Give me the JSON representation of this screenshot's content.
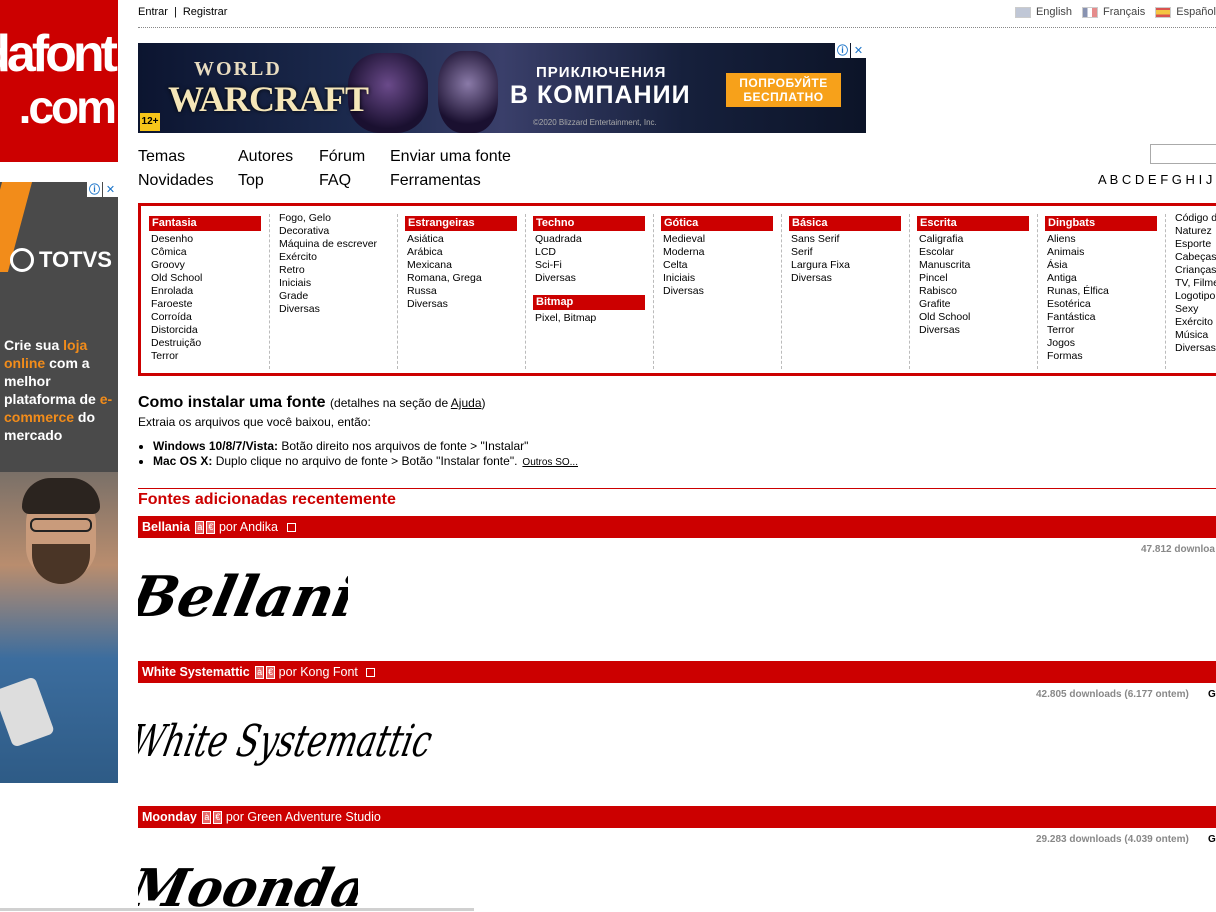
{
  "logo": {
    "line1": "dafont",
    "line2": ".com"
  },
  "left_ad": {
    "brand": "TOTVS",
    "copy_1": "Crie sua ",
    "copy_hl1": "loja online",
    "copy_2": " com a melhor plataforma de ",
    "copy_hl2": "e-commerce",
    "copy_3": " do mercado"
  },
  "top_links": {
    "login": "Entrar",
    "separator": "|",
    "register": "Registrar"
  },
  "languages": [
    {
      "flag": "en",
      "label": "English"
    },
    {
      "flag": "fr",
      "label": "Français"
    },
    {
      "flag": "es",
      "label": "Español"
    }
  ],
  "top_ad": {
    "world": "WORLD",
    "warcraft": "WARCRAFT",
    "line1": "ПРИКЛЮЧЕНИЯ",
    "line2": "В КОМПАНИИ",
    "cta": "ПОПРОБУЙТЕ БЕСПЛАТНО",
    "copyright": "©2020 Blizzard Entertainment, Inc.",
    "rating": "12+"
  },
  "nav": {
    "temas": "Temas",
    "novidades": "Novidades",
    "autores": "Autores",
    "top": "Top",
    "forum": "Fórum",
    "faq": "FAQ",
    "enviar": "Enviar uma fonte",
    "ferramentas": "Ferramentas"
  },
  "alphabet": [
    "A",
    "B",
    "C",
    "D",
    "E",
    "F",
    "G",
    "H",
    "I",
    "J"
  ],
  "categories": {
    "fantasia": {
      "title": "Fantasia",
      "items": [
        "Desenho",
        "Cômica",
        "Groovy",
        "Old School",
        "Enrolada",
        "Faroeste",
        "Corroída",
        "Distorcida",
        "Destruição",
        "Terror"
      ]
    },
    "fantasia2": {
      "items": [
        "Fogo, Gelo",
        "Decorativa",
        "Máquina de escrever",
        "Exército",
        "Retro",
        "Iniciais",
        "Grade",
        "Diversas"
      ]
    },
    "estrangeiras": {
      "title": "Estrangeiras",
      "items": [
        "Asiática",
        "Arábica",
        "Mexicana",
        "Romana, Grega",
        "Russa",
        "Diversas"
      ]
    },
    "techno": {
      "title": "Techno",
      "items": [
        "Quadrada",
        "LCD",
        "Sci-Fi",
        "Diversas"
      ]
    },
    "bitmap": {
      "title": "Bitmap",
      "items": [
        "Pixel, Bitmap"
      ]
    },
    "gotica": {
      "title": "Gótica",
      "items": [
        "Medieval",
        "Moderna",
        "Celta",
        "Iniciais",
        "Diversas"
      ]
    },
    "basica": {
      "title": "Básica",
      "items": [
        "Sans Serif",
        "Serif",
        "Largura Fixa",
        "Diversas"
      ]
    },
    "escrita": {
      "title": "Escrita",
      "items": [
        "Caligrafia",
        "Escolar",
        "Manuscrita",
        "Pincel",
        "Rabisco",
        "Grafite",
        "Old School",
        "Diversas"
      ]
    },
    "dingbats": {
      "title": "Dingbats",
      "items": [
        "Aliens",
        "Animais",
        "Ásia",
        "Antiga",
        "Runas, Élfica",
        "Esotérica",
        "Fantástica",
        "Terror",
        "Jogos",
        "Formas"
      ]
    },
    "dingbats2": {
      "items": [
        "Código d",
        "Naturez",
        "Esporte",
        "Cabeças",
        "Crianças",
        "TV, Filme",
        "Logotipo",
        "Sexy",
        "Exército",
        "Música",
        "Diversas"
      ]
    }
  },
  "install": {
    "title": "Como instalar uma fonte",
    "details_pre": "(detalhes na seção de ",
    "details_link": "Ajuda",
    "details_post": ")",
    "intro": "Extraia os arquivos que você baixou, então:",
    "win_label": "Windows 10/8/7/Vista:",
    "win_text": " Botão direito nos arquivos de fonte > \"Instalar\"",
    "mac_label": "Mac OS X:",
    "mac_text": " Duplo clique no arquivo de fonte > Botão \"Instalar fonte\".",
    "more": "Outros SO..."
  },
  "recent_title": "Fontes adicionadas recentemente",
  "fonts": [
    {
      "name": "Bellania",
      "badge1": "à",
      "badge2": "€",
      "by": "por Andika",
      "downloads": "47.812 downloa",
      "preview": "Bellania"
    },
    {
      "name": "White Systemattic",
      "badge1": "à",
      "badge2": "€",
      "by": "por Kong Font",
      "downloads": "42.805 downloads (6.177 ontem)",
      "extra": "G",
      "preview": "White Systemattic"
    },
    {
      "name": "Moonday",
      "badge1": "à",
      "badge2": "€",
      "by": "por Green Adventure Studio",
      "downloads": "29.283 downloads (4.039 ontem)",
      "extra": "G",
      "preview": "Moonday"
    }
  ]
}
